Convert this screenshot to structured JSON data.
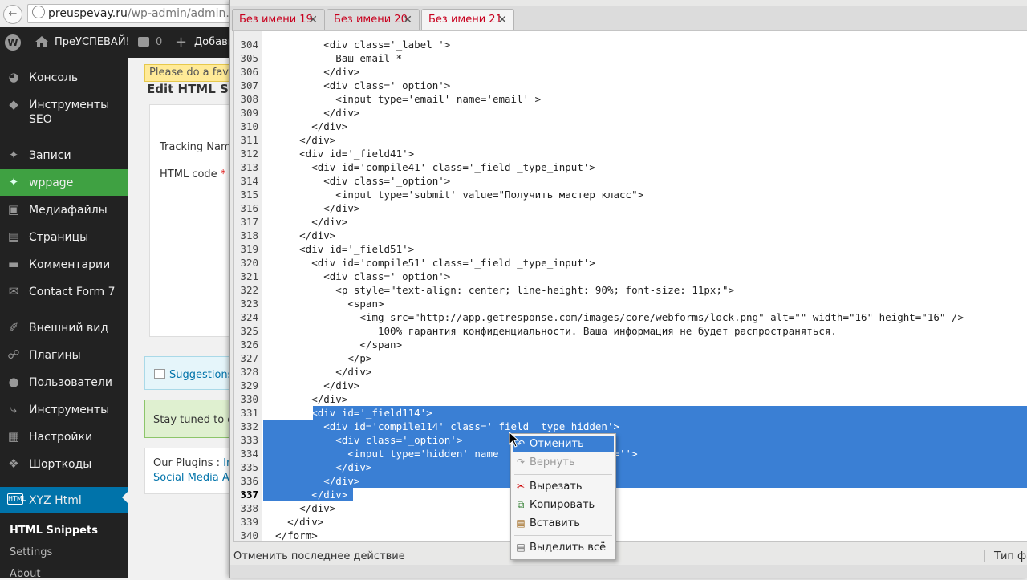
{
  "browser": {
    "url_domain": "preuspevay.ru",
    "url_path": "/wp-admin/admin.php?"
  },
  "admin_bar": {
    "site_name": "ПреУСПЕВАЙ!",
    "comments_count": "0",
    "add_label": "Добави"
  },
  "sidebar": {
    "items": [
      {
        "label": "Консоль",
        "icon": "dashboard-icon"
      },
      {
        "label": "Инструменты SEO",
        "icon": "seo-shield-icon"
      },
      {
        "label": "Записи",
        "icon": "pin-icon"
      },
      {
        "label": "wppage",
        "icon": "pin-icon"
      },
      {
        "label": "Медиафайлы",
        "icon": "media-icon"
      },
      {
        "label": "Страницы",
        "icon": "pages-icon"
      },
      {
        "label": "Комментарии",
        "icon": "comment-icon"
      },
      {
        "label": "Contact Form 7",
        "icon": "mail-icon"
      },
      {
        "label": "Внешний вид",
        "icon": "brush-icon"
      },
      {
        "label": "Плагины",
        "icon": "plugin-icon"
      },
      {
        "label": "Пользователи",
        "icon": "user-icon"
      },
      {
        "label": "Инструменты",
        "icon": "wrench-icon"
      },
      {
        "label": "Настройки",
        "icon": "settings-icon"
      },
      {
        "label": "Шорткоды",
        "icon": "shortcode-icon"
      },
      {
        "label": "XYZ Html",
        "icon": "html-icon"
      }
    ],
    "submenu": [
      "HTML Snippets",
      "Settings",
      "About"
    ]
  },
  "page": {
    "notice": "Please do a favou",
    "heading": "Edit HTML Snip",
    "tracking_label": "Tracking Name",
    "html_code_label": "HTML code",
    "required_mark": "*",
    "suggestions": "Suggestions",
    "stay_tuned": "Stay tuned to ou",
    "plugins_label": "Our Plugins : ",
    "plugins_link": "Ins",
    "social_link": "Social Media Aut"
  },
  "editor": {
    "tabs": [
      {
        "name": "Без имени 19",
        "active": false
      },
      {
        "name": "Без имени 20",
        "active": false
      },
      {
        "name": "Без имени 21",
        "active": true
      }
    ],
    "tab_close": "✕",
    "current_line": "337",
    "lines": [
      {
        "n": "304",
        "text": "          <div class='_label '>",
        "sel": false
      },
      {
        "n": "305",
        "text": "            Ваш email *",
        "sel": false
      },
      {
        "n": "306",
        "text": "          </div>",
        "sel": false
      },
      {
        "n": "307",
        "text": "          <div class='_option'>",
        "sel": false
      },
      {
        "n": "308",
        "text": "            <input type='email' name='email' >",
        "sel": false
      },
      {
        "n": "309",
        "text": "          </div>",
        "sel": false
      },
      {
        "n": "310",
        "text": "        </div>",
        "sel": false
      },
      {
        "n": "311",
        "text": "      </div>",
        "sel": false
      },
      {
        "n": "312",
        "text": "      <div id='_field41'>",
        "sel": false
      },
      {
        "n": "313",
        "text": "        <div id='compile41' class='_field _type_input'>",
        "sel": false
      },
      {
        "n": "314",
        "text": "          <div class='_option'>",
        "sel": false
      },
      {
        "n": "315",
        "text": "            <input type='submit' value=\"Получить мастер класс\">",
        "sel": false
      },
      {
        "n": "316",
        "text": "          </div>",
        "sel": false
      },
      {
        "n": "317",
        "text": "        </div>",
        "sel": false
      },
      {
        "n": "318",
        "text": "      </div>",
        "sel": false
      },
      {
        "n": "319",
        "text": "      <div id='_field51'>",
        "sel": false
      },
      {
        "n": "320",
        "text": "        <div id='compile51' class='_field _type_input'>",
        "sel": false
      },
      {
        "n": "321",
        "text": "          <div class='_option'>",
        "sel": false
      },
      {
        "n": "322",
        "text": "            <p style=\"text-align: center; line-height: 90%; font-size: 11px;\">",
        "sel": false
      },
      {
        "n": "323",
        "text": "              <span>",
        "sel": false
      },
      {
        "n": "324",
        "text": "                <img src=\"http://app.getresponse.com/images/core/webforms/lock.png\" alt=\"\" width=\"16\" height=\"16\" />",
        "sel": false
      },
      {
        "n": "325",
        "text": "                   100% гарантия конфиденциальности. Ваша информация не будет распространяться.",
        "sel": false
      },
      {
        "n": "326",
        "text": "                </span>",
        "sel": false
      },
      {
        "n": "327",
        "text": "              </p>",
        "sel": false
      },
      {
        "n": "328",
        "text": "            </div>",
        "sel": false
      },
      {
        "n": "329",
        "text": "          </div>",
        "sel": false
      },
      {
        "n": "330",
        "text": "        </div>",
        "sel": false
      },
      {
        "n": "331",
        "text": "        <div id='_field114'>",
        "sel": true
      },
      {
        "n": "332",
        "text": "          <div id='compile114' class='_field _type_hidden'>",
        "sel": true
      },
      {
        "n": "333",
        "text": "            <div class='_option'>",
        "sel": true
      },
      {
        "n": "334",
        "text": "              <input type='hidden' name                  e=''>",
        "sel": true
      },
      {
        "n": "335",
        "text": "            </div>",
        "sel": true
      },
      {
        "n": "336",
        "text": "          </div>",
        "sel": true
      },
      {
        "n": "337",
        "text": "        </div>",
        "sel": true
      },
      {
        "n": "338",
        "text": "      </div>",
        "sel": false
      },
      {
        "n": "339",
        "text": "    </div>",
        "sel": false
      },
      {
        "n": "340",
        "text": "  </form>",
        "sel": false
      }
    ],
    "status_text": "Отменить последнее действие",
    "status_right": "Тип фа"
  },
  "context_menu": [
    {
      "label": "Отменить",
      "icon": "undo-icon",
      "disabled": false,
      "highlighted": true
    },
    {
      "label": "Вернуть",
      "icon": "redo-icon",
      "disabled": true,
      "highlighted": false
    },
    {
      "label": "Вырезать",
      "icon": "scissors-icon",
      "disabled": false,
      "highlighted": false
    },
    {
      "label": "Копировать",
      "icon": "copy-icon",
      "disabled": false,
      "highlighted": false
    },
    {
      "label": "Вставить",
      "icon": "paste-icon",
      "disabled": false,
      "highlighted": false
    },
    {
      "label": "Выделить всё",
      "icon": "select-all-icon",
      "disabled": false,
      "highlighted": false
    }
  ],
  "colors": {
    "wp_sidebar": "#222222",
    "wp_active_green": "#3fa142",
    "wp_active_blue": "#0073aa",
    "selection": "#3a7fd4",
    "tab_text": "#c8001e"
  }
}
